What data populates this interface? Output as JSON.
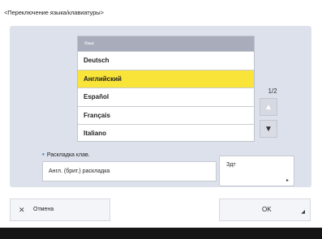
{
  "dialog": {
    "title": "<Переключение языка/клавиатуры>"
  },
  "language_list": {
    "header": "Язык",
    "items": [
      "Deutsch",
      "Английский",
      "Español",
      "Français",
      "Italiano"
    ],
    "selected_index": 1
  },
  "pager": {
    "indicator": "1/2"
  },
  "keyboard": {
    "label": "Раскладка клав.",
    "value": "Англ. (брит.) раскладка",
    "change_button_label": "Здт"
  },
  "footer": {
    "cancel_label": "Отмена",
    "ok_label": "OK"
  },
  "colors": {
    "selected_row": "#f9e43a",
    "panel_bg": "#dde1ec",
    "header_bg": "#a9adbb",
    "accent_dot": "#1f6fd1"
  },
  "icons": {
    "scroll_up": "arrow-up-icon",
    "scroll_down": "arrow-down-icon",
    "cancel": "close-icon",
    "corner": "corner-arrow-icon"
  }
}
